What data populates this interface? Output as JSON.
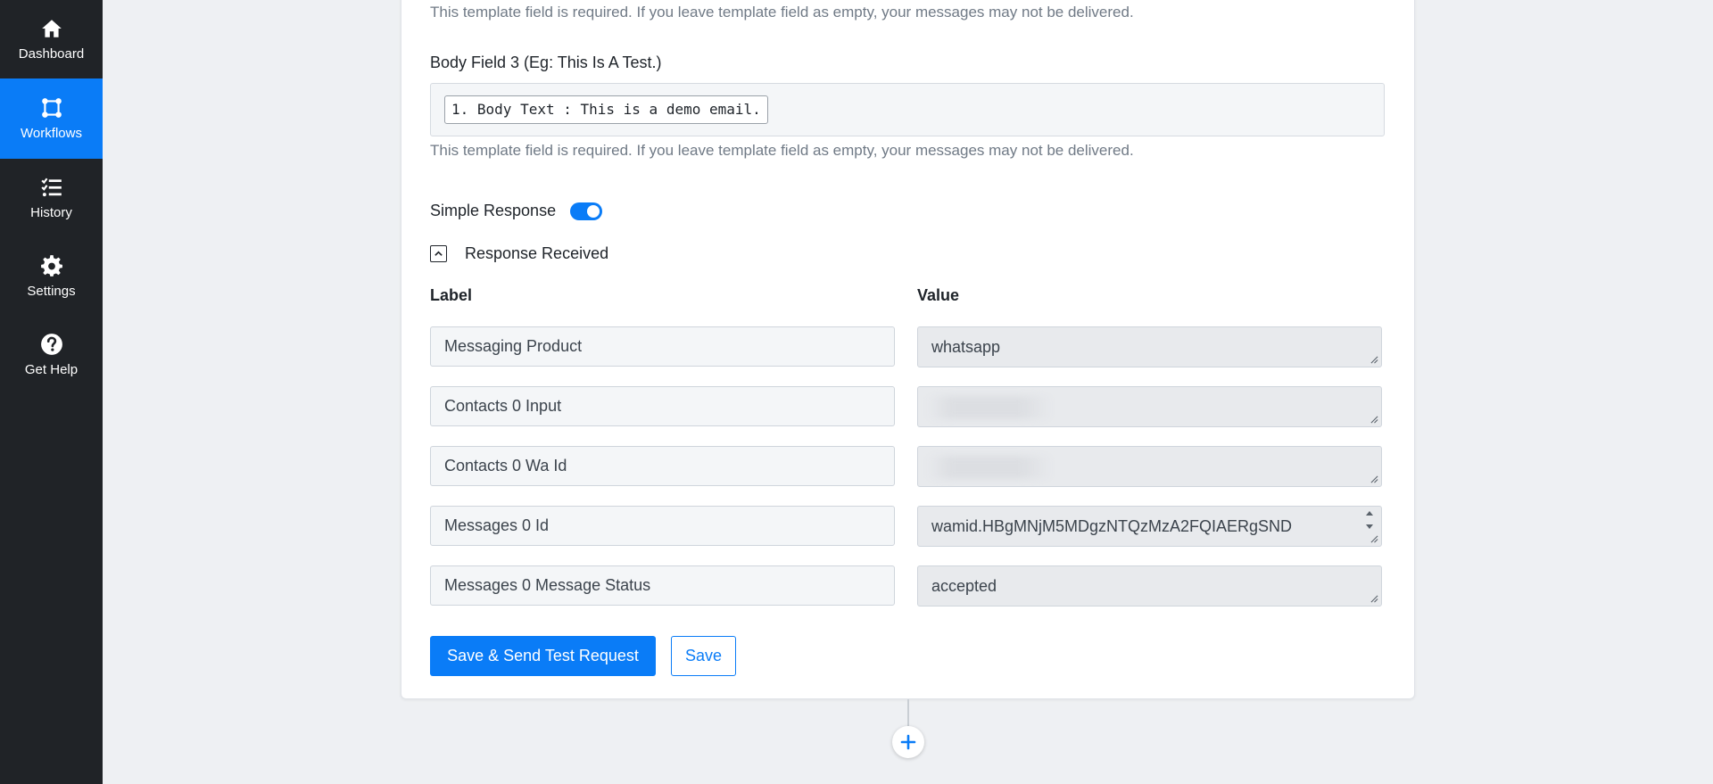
{
  "sidebar": {
    "items": [
      {
        "label": "Dashboard",
        "icon": "home-icon"
      },
      {
        "label": "Workflows",
        "icon": "workflow-icon",
        "active": true
      },
      {
        "label": "History",
        "icon": "history-list-icon"
      },
      {
        "label": "Settings",
        "icon": "gear-icon"
      },
      {
        "label": "Get Help",
        "icon": "help-icon"
      }
    ]
  },
  "form": {
    "required_hint": "This template field is required. If you leave template field as empty, your messages may not be delivered.",
    "body_field_3": {
      "label": "Body Field 3 (Eg: This Is A Test.)",
      "token": "1. Body Text : This is a demo email."
    },
    "simple_response_label": "Simple Response",
    "response_received_label": "Response Received",
    "columns": {
      "label": "Label",
      "value": "Value"
    },
    "rows": [
      {
        "label": "Messaging Product",
        "value": "whatsapp"
      },
      {
        "label": "Contacts 0 Input",
        "value": ""
      },
      {
        "label": "Contacts 0 Wa Id",
        "value": ""
      },
      {
        "label": "Messages 0 Id",
        "value": "wamid.HBgMNjM5MDgzNTQzMzA2FQIAERgSND"
      },
      {
        "label": "Messages 0 Message Status",
        "value": "accepted"
      }
    ],
    "buttons": {
      "save_and_test": "Save & Send Test Request",
      "save": "Save"
    }
  },
  "colors": {
    "accent": "#0a7cf7",
    "sidebar_bg": "#202327"
  }
}
